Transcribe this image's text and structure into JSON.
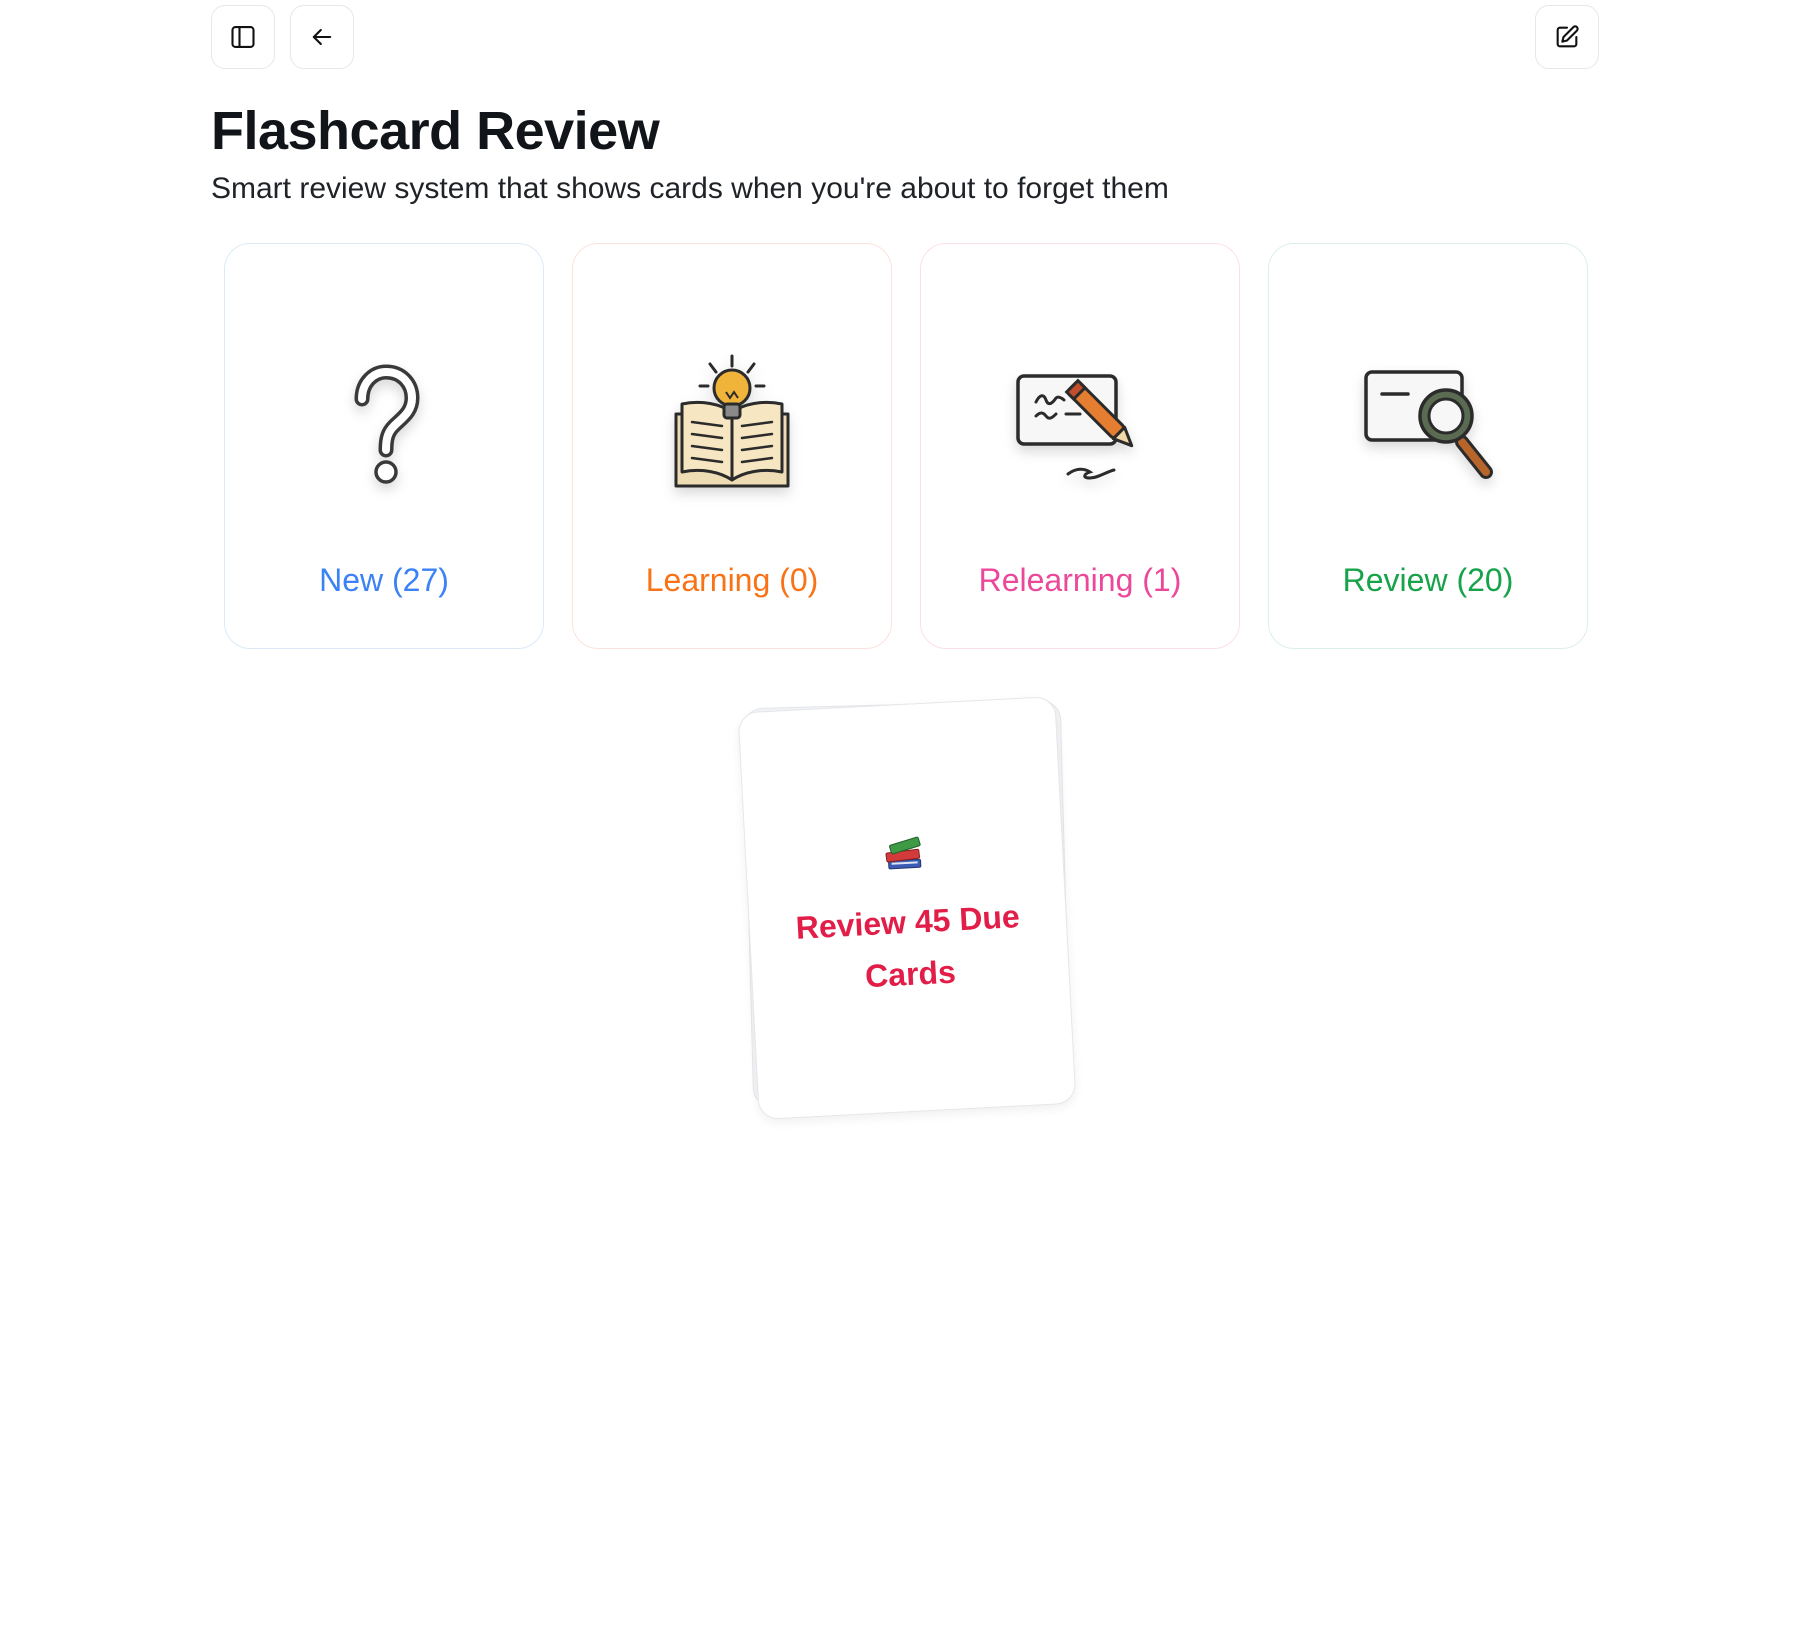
{
  "header": {
    "title": "Flashcard Review",
    "subtitle": "Smart review system that shows cards when you're about to forget them"
  },
  "toolbar": {
    "left_icons": [
      "sidebar-toggle-icon",
      "arrow-left-icon"
    ],
    "right_icons": [
      "edit-icon"
    ]
  },
  "stats": [
    {
      "key": "new",
      "label": "New (27)",
      "color": "#3b82f6",
      "icon": "question-mark-icon"
    },
    {
      "key": "learning",
      "label": "Learning (0)",
      "color": "#f97316",
      "icon": "open-book-lightbulb-icon"
    },
    {
      "key": "relearning",
      "label": "Relearning (1)",
      "color": "#ec4899",
      "icon": "card-pencil-icon"
    },
    {
      "key": "review",
      "label": "Review (20)",
      "color": "#16a34a",
      "icon": "card-magnifier-icon"
    }
  ],
  "deck": {
    "icon": "books-icon",
    "cta_label": "Review 45 Due Cards",
    "cta_color": "#e11d48"
  }
}
